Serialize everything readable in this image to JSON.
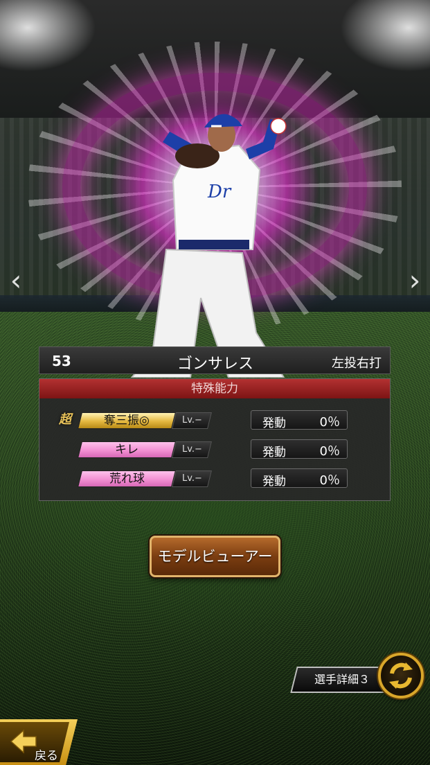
{
  "player": {
    "number": "53",
    "name": "ゴンサレス",
    "handedness": "左投右打"
  },
  "abilities": {
    "header": "特殊能力",
    "items": [
      {
        "tag": "超",
        "name": "奪三振◎",
        "level": "Lv.−",
        "status_label": "発動",
        "status_value": "0％",
        "style": "gold"
      },
      {
        "tag": "",
        "name": "キレ",
        "level": "Lv.−",
        "status_label": "発動",
        "status_value": "0％",
        "style": "pink"
      },
      {
        "tag": "",
        "name": "荒れ球",
        "level": "Lv.−",
        "status_label": "発動",
        "status_value": "0％",
        "style": "pink"
      }
    ]
  },
  "buttons": {
    "model_viewer": "モデルビューアー",
    "player_detail": "選手詳細３",
    "back": "戻る"
  },
  "navigation": {
    "prev_icon": "chevron-left-icon",
    "next_icon": "chevron-right-icon",
    "prev_glyph": "‹",
    "next_glyph": "›"
  },
  "colors": {
    "header_red": "#b33131",
    "gold_ability": "#e5b840",
    "pink_ability": "#f28fd2",
    "button_brown": "#7b3d11",
    "button_border": "#e1b46b"
  }
}
